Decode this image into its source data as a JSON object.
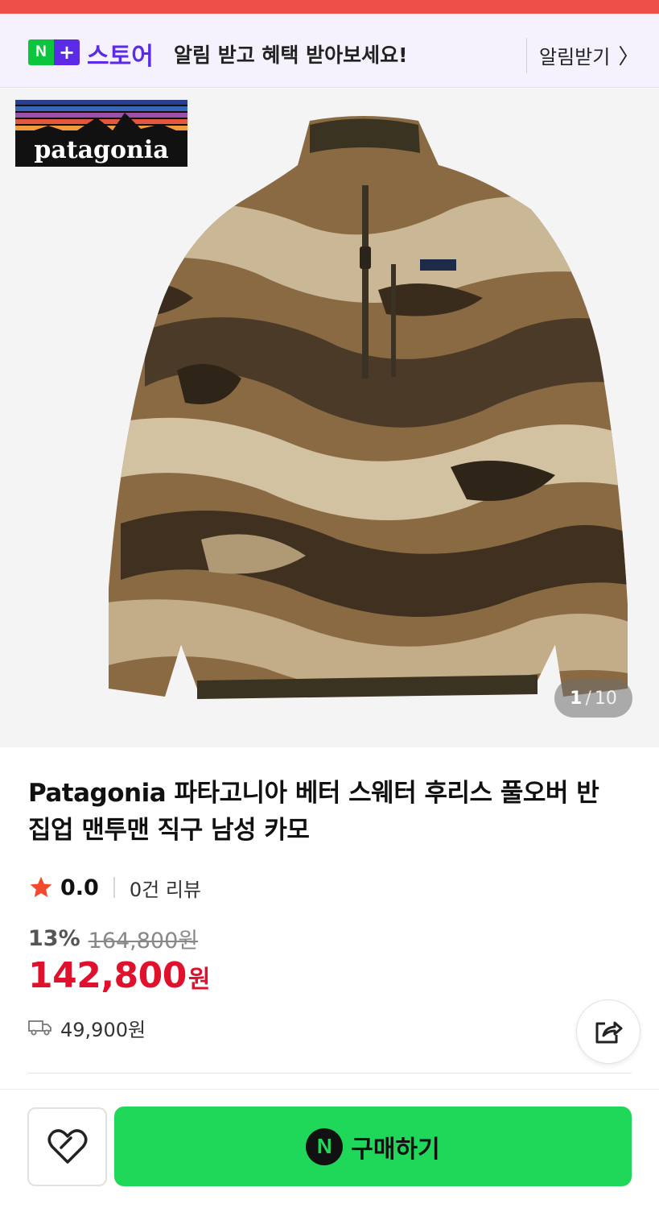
{
  "banner": {
    "badge_n": "N",
    "badge_plus": "+",
    "store_label": "스토어",
    "message": "알림 받고 혜택 받아보세요!",
    "notify_label": "알림받기",
    "notify_chevron": "〉"
  },
  "gallery": {
    "brand_logo_text": "patagonia",
    "current": "1",
    "separator": "/",
    "total": "10"
  },
  "product": {
    "title": "Patagonia 파타고니아 베터 스웨터 후리스 풀오버 반집업 맨투맨 직구 남성 카모",
    "rating": "0.0",
    "review_count": "0건 리뷰",
    "discount": "13%",
    "original_price": "164,800원",
    "price": "142,800",
    "price_unit": "원",
    "shipping_fee": "49,900원"
  },
  "actions": {
    "buy_icon_letter": "N",
    "buy_label": "구매하기"
  },
  "colors": {
    "accent_red": "#ef4f49",
    "price_red": "#e0112c",
    "buy_green": "#1fd85a",
    "naver_purple": "#5b2be8",
    "naver_green": "#0bc53c"
  },
  "icons": [
    "chevron-right-icon",
    "star-icon",
    "truck-icon",
    "share-icon",
    "heart-icon",
    "naver-pay-icon"
  ]
}
